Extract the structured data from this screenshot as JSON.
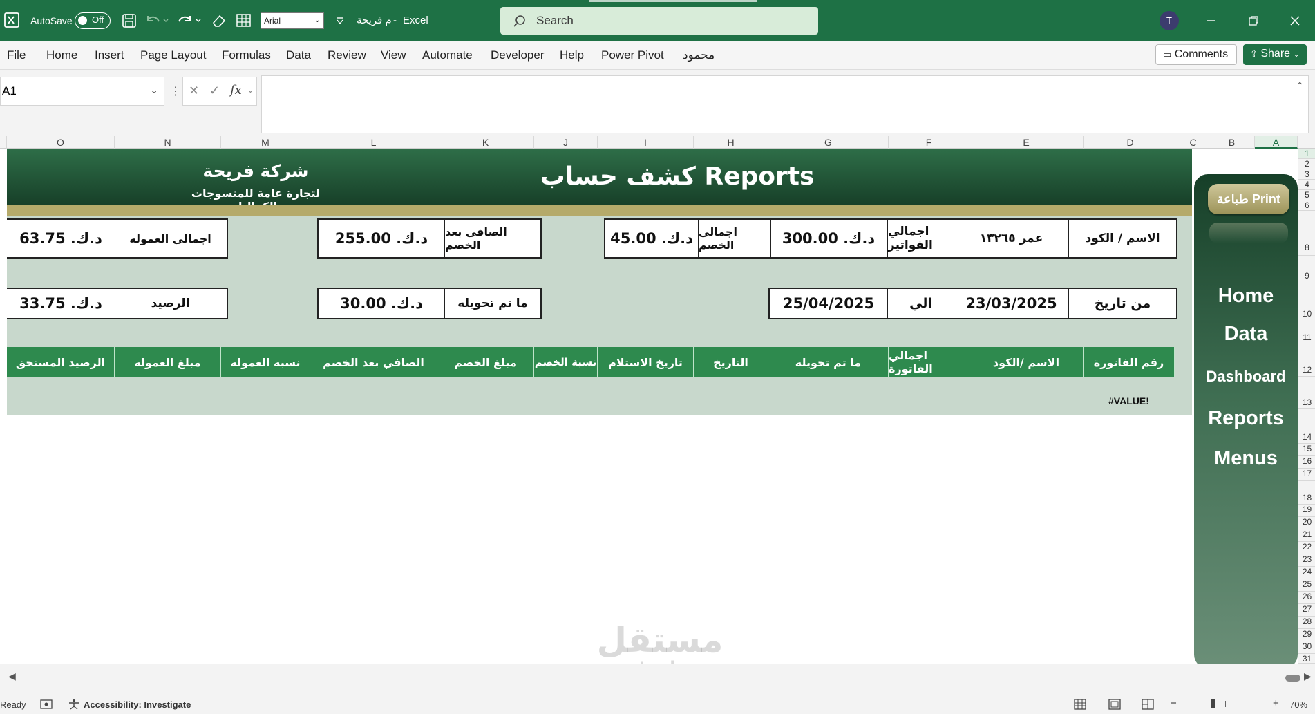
{
  "titlebar": {
    "autosave_label": "AutoSave",
    "autosave_state": "Off",
    "font_name": "Arial",
    "doc_name": "م فريحة",
    "app_name": "Excel",
    "search_placeholder": "Search",
    "avatar_initial": "T",
    "accent": "#1e7145"
  },
  "ribbon": {
    "tabs": [
      "File",
      "Home",
      "Insert",
      "Page Layout",
      "Formulas",
      "Data",
      "Review",
      "View",
      "Automate",
      "Developer",
      "Help",
      "Power Pivot",
      "محمود"
    ],
    "comments_label": "Comments",
    "share_label": "Share"
  },
  "formula_bar": {
    "cell_ref": "A1",
    "fx_label": "fx",
    "formula": ""
  },
  "columns": [
    "O",
    "N",
    "M",
    "L",
    "K",
    "J",
    "I",
    "H",
    "G",
    "F",
    "E",
    "D",
    "C",
    "B",
    "A"
  ],
  "rows": [
    "1",
    "2",
    "3",
    "4",
    "5",
    "6",
    "8",
    "9",
    "10",
    "11",
    "12",
    "13",
    "14",
    "15",
    "16",
    "17",
    "18",
    "19",
    "20",
    "21",
    "22",
    "23",
    "24",
    "25",
    "26",
    "27",
    "28",
    "29",
    "30",
    "31"
  ],
  "report": {
    "company_name": "شركة فريحة",
    "company_tagline": "لتجارة عامة للمنسوجات والكماليات",
    "title": "كشف حساب  Reports",
    "summary_row1": {
      "name_label": "الاسم / الكود",
      "name_value": "عمر ١٣٢٦٥",
      "invoices_label": "اجمالي الفواتير",
      "invoices_value": "د.ك. 300.00",
      "discount_label": "اجمالي الخصم",
      "discount_value": "د.ك. 45.00",
      "net_label": "الصافي بعد الخصم",
      "net_value": "د.ك. 255.00",
      "commission_label": "اجمالي العموله",
      "commission_value": "د.ك. 63.75"
    },
    "summary_row2": {
      "from_label": "من تاريخ",
      "from_value": "23/03/2025",
      "to_label": "الي",
      "to_value": "25/04/2025",
      "transferred_label": "ما تم تحويله",
      "transferred_value": "د.ك. 30.00",
      "balance_label": "الرصيد",
      "balance_value": "د.ك. 33.75"
    },
    "table_headers": [
      "رقم الفاتورة",
      "الاسم /الكود",
      "اجمالي الفاتورة",
      "ما تم تحويله",
      "التاريخ",
      "تاريخ الاستلام",
      "نسبة الخصم",
      "مبلغ الخصم",
      "الصافي بعد الخصم",
      "نسبه العموله",
      "مبلغ العموله",
      "الرصيد المستحق"
    ],
    "error_value": "#VALUE!"
  },
  "sidenav": {
    "print_label": "طباعة Print",
    "items": [
      "Home",
      "Data",
      "Dashboard",
      "Reports",
      "Menus"
    ]
  },
  "watermark": {
    "arabic": "مستقل",
    "latin": "mostaql.com"
  },
  "status": {
    "ready": "Ready",
    "accessibility": "Accessibility: Investigate",
    "zoom": "70%"
  }
}
